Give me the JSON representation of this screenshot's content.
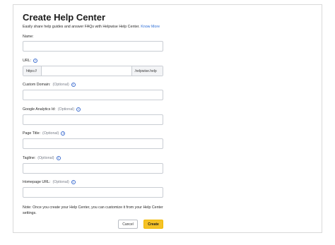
{
  "form": {
    "title": "Create Help Center",
    "subtitle": "Easily share help guides and answer FAQs with Helpwise Help Center.",
    "know_more": "Know More",
    "fields": {
      "name": {
        "label": "Name:"
      },
      "url": {
        "label": "URL:",
        "prefix": "https://",
        "suffix": ".helpwise.help",
        "info_icon": "info-icon"
      },
      "custom_domain": {
        "label": "Custom Domain:",
        "optional": "(Optional)",
        "info_icon": "info-icon"
      },
      "google_analytics": {
        "label": "Google Analytics Id:",
        "optional": "(Optional)",
        "info_icon": "info-icon"
      },
      "page_title": {
        "label": "Page Title:",
        "optional": "(Optional)",
        "info_icon": "info-icon"
      },
      "tagline": {
        "label": "Tagline:",
        "optional": "(Optional)",
        "info_icon": "info-icon"
      },
      "homepage_url": {
        "label": "Homepage URL:",
        "optional": "(Optional)",
        "info_icon": "info-icon"
      }
    },
    "note": "Note: Once you create your Help Center, you can customize it from your Help Center settings.",
    "cancel_label": "Cancel",
    "create_label": "Create",
    "colors": {
      "primary_button": "#f5c227",
      "link": "#2f6fd6",
      "info_icon": "#3f6fd0"
    }
  }
}
